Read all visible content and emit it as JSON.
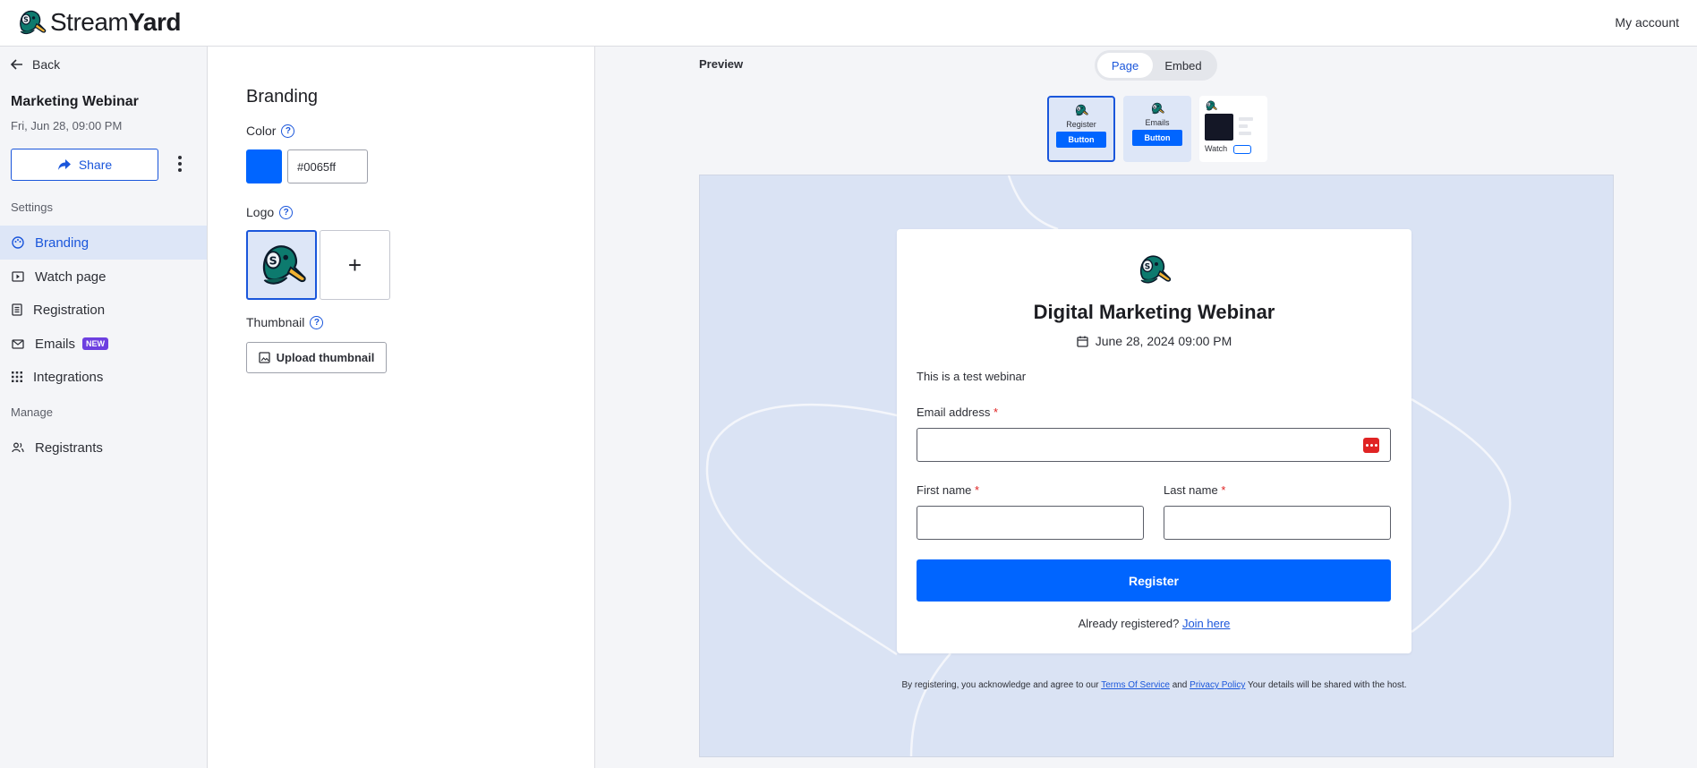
{
  "app": {
    "brand_part1": "Stream",
    "brand_part2": "Yard",
    "my_account": "My account"
  },
  "sidebar": {
    "back_label": "Back",
    "event_title": "Marketing Webinar",
    "event_date": "Fri, Jun 28, 09:00 PM",
    "share_label": "Share",
    "settings_label": "Settings",
    "manage_label": "Manage",
    "items": [
      {
        "label": "Branding",
        "icon": "palette-icon",
        "active": true
      },
      {
        "label": "Watch page",
        "icon": "play-screen-icon",
        "active": false
      },
      {
        "label": "Registration",
        "icon": "form-list-icon",
        "active": false
      },
      {
        "label": "Emails",
        "icon": "envelope-icon",
        "active": false,
        "badge": "NEW"
      },
      {
        "label": "Integrations",
        "icon": "grid-dots-icon",
        "active": false
      }
    ],
    "manage_items": [
      {
        "label": "Registrants",
        "icon": "people-icon"
      }
    ]
  },
  "branding": {
    "title": "Branding",
    "color_label": "Color",
    "color_value": "#0065ff",
    "logo_label": "Logo",
    "add_logo": "+",
    "thumbnail_label": "Thumbnail",
    "upload_label": "Upload thumbnail"
  },
  "preview": {
    "label": "Preview",
    "tabs": [
      "Page",
      "Embed"
    ],
    "active_tab": "Page",
    "thumbs": [
      {
        "label": "Register",
        "button": "Button"
      },
      {
        "label": "Emails",
        "button": "Button"
      },
      {
        "label": "Watch"
      }
    ],
    "card": {
      "title": "Digital Marketing Webinar",
      "date": "June 28, 2024 09:00 PM",
      "description": "This is a test webinar",
      "email_label": "Email address",
      "first_name_label": "First name",
      "last_name_label": "Last name",
      "required_mark": "*",
      "register_label": "Register",
      "already_text": "Already registered?",
      "join_link": "Join here"
    },
    "legal": {
      "prefix": "By registering, you acknowledge and agree to our",
      "terms": "Terms Of Service",
      "and": "and",
      "privacy": "Privacy Policy",
      "suffix": "Your details will be shared with the host."
    }
  },
  "colors": {
    "accent": "#1a56db",
    "brand": "#0065ff",
    "badge": "#6d3fe0",
    "required": "#e02424",
    "canvas_bg": "#dae3f4"
  }
}
